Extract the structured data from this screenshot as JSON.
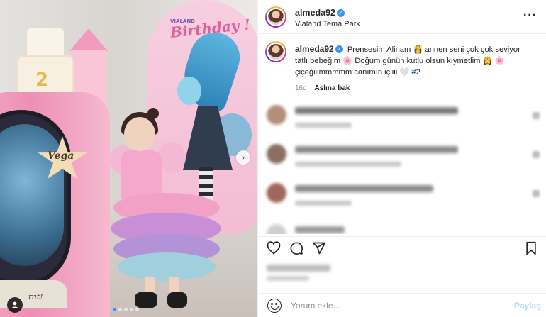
{
  "header": {
    "username": "almeda92",
    "location": "Vialand Tema Park",
    "more_icon": "more-horizontal-icon"
  },
  "photo": {
    "banner_brand": "VIALAND",
    "banner_title": "Birthday !",
    "cake_star_text": "Vega",
    "cake_number": "2",
    "cutout_text": "rat!",
    "carousel": {
      "dots": 5,
      "active_index": 0
    },
    "next_icon": "chevron-right-icon",
    "user_tag_icon": "user-tag-icon"
  },
  "caption": {
    "username": "almeda92",
    "line1": "Prensesim Alinam 👸 annen seni çok çok seviyor",
    "line2": "tatlı bebeğim 🌸 Doğum günün kutlu olsun kıymetlim 👸 🌸",
    "line3": "çiçeğiiimmmmm canımın içiiii 🤍 ",
    "hashtag": "#2",
    "age": "16d",
    "see_translation": "Aslına bak"
  },
  "comments": [
    {
      "avatar_color": "#b38e7a",
      "text_color": "#7a7a7a",
      "w1": 230
    },
    {
      "avatar_color": "#8a6f64",
      "text_color": "#8a8a8a",
      "w1": 230
    },
    {
      "avatar_color": "#a0675a",
      "text_color": "#8a8a8a",
      "w1": 195
    },
    {
      "avatar_color": "#cfcfcf",
      "text_color": "#9a9a9a",
      "w1": 70
    }
  ],
  "actions": {
    "like_icon": "heart-icon",
    "comment_icon": "comment-icon",
    "share_icon": "share-icon",
    "save_icon": "bookmark-icon"
  },
  "add_comment": {
    "placeholder": "Yorum ekle...",
    "post_label": "Paylaş",
    "emoji_icon": "emoji-icon"
  },
  "colors": {
    "accent": "#3897f0",
    "post_button_disabled": "#b3dbff"
  }
}
